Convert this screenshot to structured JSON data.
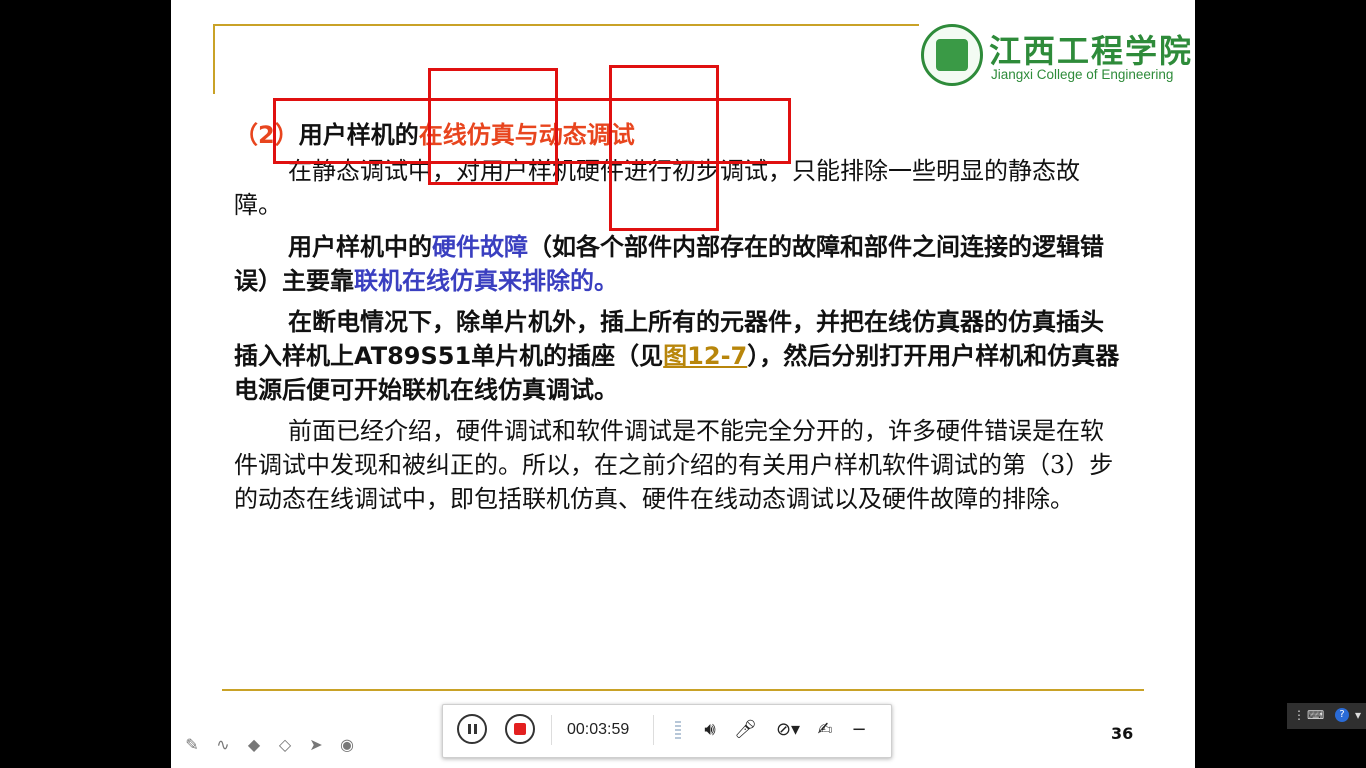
{
  "slide": {
    "logo": {
      "name_cn": "江西工程学院",
      "name_en": "Jiangxi College of Engineering"
    },
    "heading": {
      "number": "（2）",
      "prefix": "用户样机的",
      "highlight": "在线仿真与动态调试"
    },
    "para1": "在静态调试中，对用户样机硬件进行初步调试，只能排除一些明显的静态故障。",
    "para2": {
      "a": "用户样机中的",
      "b": "硬件故障",
      "c": "（如各个部件内部存在的故障和部件之间连接的逻辑错误）主要靠",
      "d": "联机在线仿真来排除的。"
    },
    "para3": {
      "a": "在断电情况下，除单片机外，插上所有的元器件，并把在线仿真器的仿真插头插入样机上AT89S51单片机的插座（见",
      "link": "图12-7",
      "b": "），然后分别打开用户样机和仿真器电源后便可开始联机在线仿真调试。"
    },
    "para4": "前面已经介绍，硬件调试和软件调试是不能完全分开的，许多硬件错误是在软件调试中发现和被纠正的。所以，在之前介绍的有关用户样机软件调试的第（3）步的动态在线调试中，即包括联机仿真、硬件在线动态调试以及硬件故障的排除。",
    "slide_number": "36"
  },
  "pen_tools": [
    "pen-icon",
    "curve-icon",
    "marker-icon",
    "eraser-icon",
    "pointer-icon",
    "laser-icon"
  ],
  "recorder": {
    "timer": "00:03:59",
    "icons": [
      "pause-icon",
      "stop-icon",
      "speaker-icon",
      "microphone-icon",
      "camera-off-icon",
      "annotate-icon",
      "minimize-icon"
    ]
  },
  "colors": {
    "accent_red": "#e8451e",
    "accent_blue": "#3a3fc0",
    "rule_gold": "#c9a227",
    "logo_green": "#2e8b3a",
    "annotation_red": "#e01010"
  }
}
